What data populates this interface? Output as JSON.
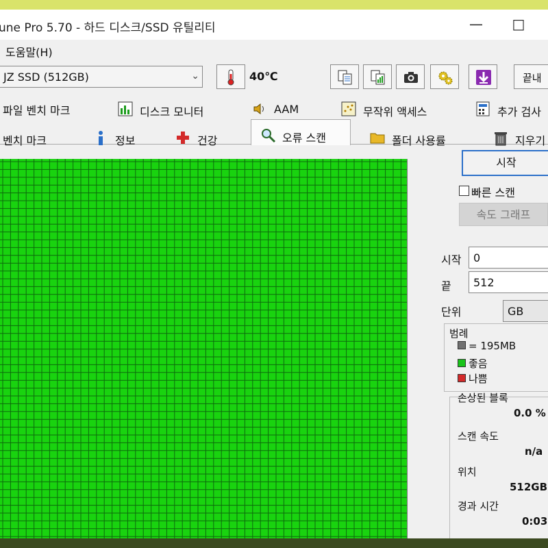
{
  "window": {
    "title": "une Pro 5.70 - 하드 디스크/SSD 유틸리티",
    "minimize_glyph": "—",
    "maximize_glyph": "□"
  },
  "menu": {
    "help": "도움말(H)"
  },
  "toolbar": {
    "drive": "JZ SSD (512GB)",
    "temperature": "40℃",
    "exit_label": "끝내"
  },
  "tabs": {
    "row1": [
      "파일 벤치 마크",
      "디스크 모니터",
      "AAM",
      "무작위 액세스",
      "추가 검사"
    ],
    "row2": [
      "벤치 마크",
      "정보",
      "건강",
      "오류 스캔",
      "폴더 사용률",
      "지우기"
    ],
    "active": "오류 스캔"
  },
  "scan": {
    "block_color": "#19d30f",
    "line_color": "#0d6a0d",
    "status": "좋음",
    "progress": 1.0
  },
  "panel": {
    "start_button": "시작",
    "quick_scan_label": "빠른 스캔",
    "quick_scan_checked": false,
    "speed_graph_button": "속도 그래프",
    "start_label": "시작",
    "start_value": "0",
    "end_label": "끝",
    "end_value": "512",
    "unit_label": "단위",
    "unit_value": "GB",
    "legend_title": "범례",
    "legend_block": "= 195MB",
    "legend_good": "좋음",
    "legend_bad": "나쁨",
    "legend_colors": {
      "block": "#707070",
      "good": "#19c41a",
      "bad": "#d32a2a"
    },
    "damaged_label": "손상된 블록",
    "damaged_value": "0.0 %",
    "speed_label": "스캔 속도",
    "speed_value": "n/a",
    "position_label": "위치",
    "position_value": "512GB",
    "elapsed_label": "경과 시간",
    "elapsed_value": "0:03"
  }
}
